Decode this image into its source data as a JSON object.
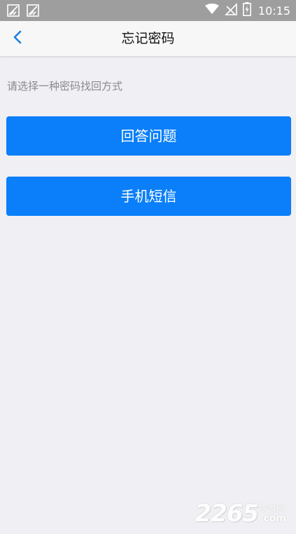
{
  "status_bar": {
    "time": "10:15",
    "icons": [
      "notification-icon",
      "notification-icon",
      "wifi-icon",
      "signal-off-icon",
      "battery-charging-icon"
    ]
  },
  "nav": {
    "title": "忘记密码",
    "back_icon": "chevron-left-icon"
  },
  "hint": "请选择一种密码找回方式",
  "options": [
    {
      "label": "回答问题"
    },
    {
      "label": "手机短信"
    }
  ],
  "watermark": {
    "number": "2265",
    "site_cn": "手游网",
    "domain": ".com"
  },
  "colors": {
    "status_bar": "#9e9e9e",
    "nav_bg": "#f7f7f7",
    "page_bg": "#efeff4",
    "accent": "#0a7ff9",
    "back_icon": "#1a7fe0"
  }
}
